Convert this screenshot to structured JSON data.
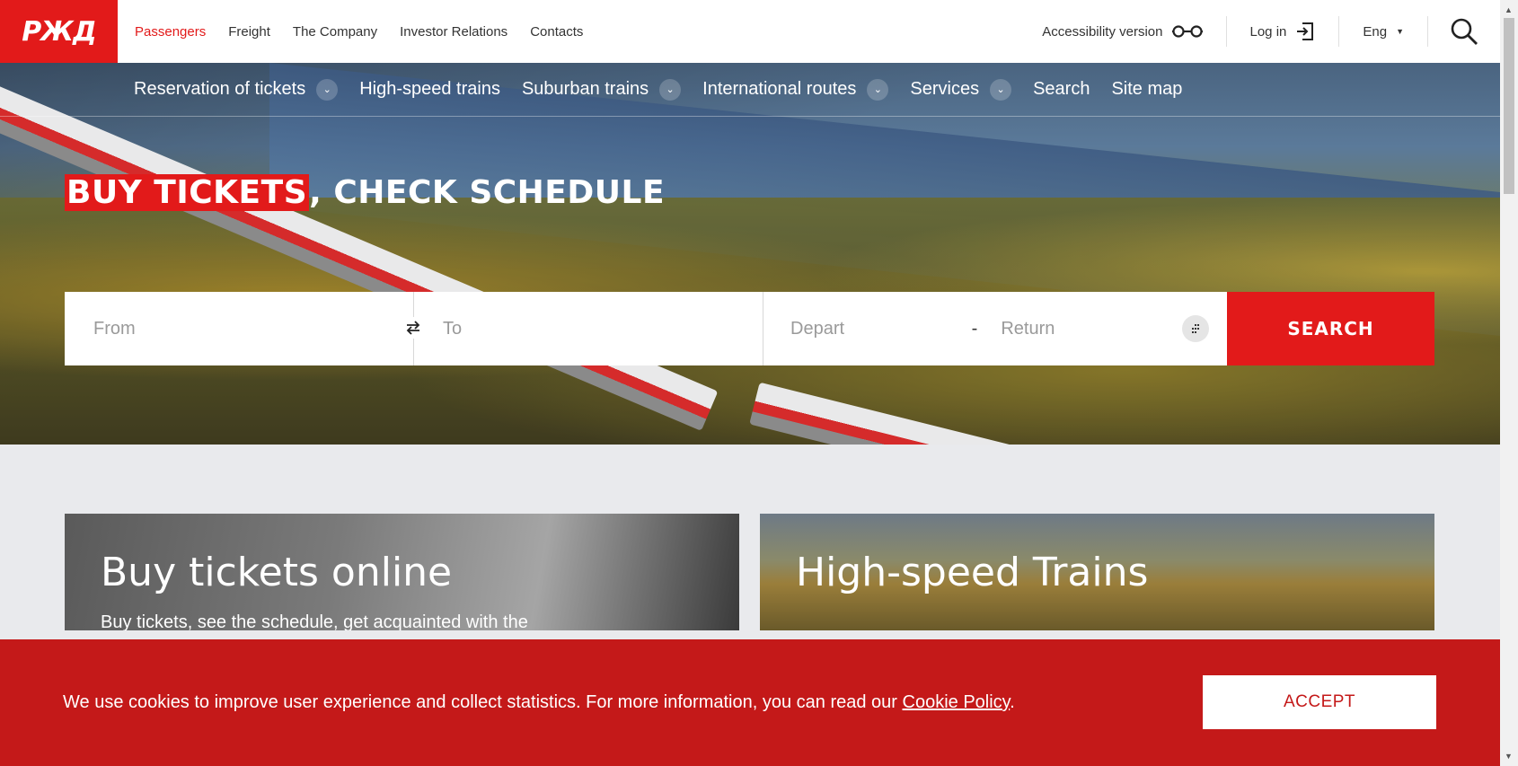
{
  "brand": {
    "logo_text": "РЖД",
    "accent_color": "#e21a1a"
  },
  "topnav": {
    "items": [
      "Passengers",
      "Freight",
      "The Company",
      "Investor Relations",
      "Contacts"
    ],
    "active": "Passengers"
  },
  "topright": {
    "accessibility": "Accessibility version",
    "login": "Log in",
    "language": "Eng"
  },
  "subnav": {
    "reservation": "Reservation of tickets",
    "highspeed": "High-speed trains",
    "suburban": "Suburban trains",
    "international": "International routes",
    "services": "Services",
    "search": "Search",
    "sitemap": "Site map"
  },
  "hero": {
    "title_highlight": "BUY TICKETS",
    "title_rest": ", CHECK SCHEDULE"
  },
  "searchform": {
    "from_placeholder": "From",
    "to_placeholder": "To",
    "depart_placeholder": "Depart",
    "dash": "-",
    "return_placeholder": "Return",
    "button": "SEARCH"
  },
  "cards": {
    "buy_title": "Buy tickets online",
    "buy_text": "Buy tickets, see the schedule, get acquainted with the",
    "highspeed_title": "High-speed Trains"
  },
  "cookie": {
    "text": "We use cookies to improve user experience and collect statistics. For more information, you can read our ",
    "link": "Cookie Policy",
    "end": ".",
    "accept": "ACCEPT"
  },
  "icons": [
    "glasses-icon",
    "login-icon",
    "search-icon",
    "swap-icon",
    "calendar-icon",
    "chevron-down-icon"
  ]
}
